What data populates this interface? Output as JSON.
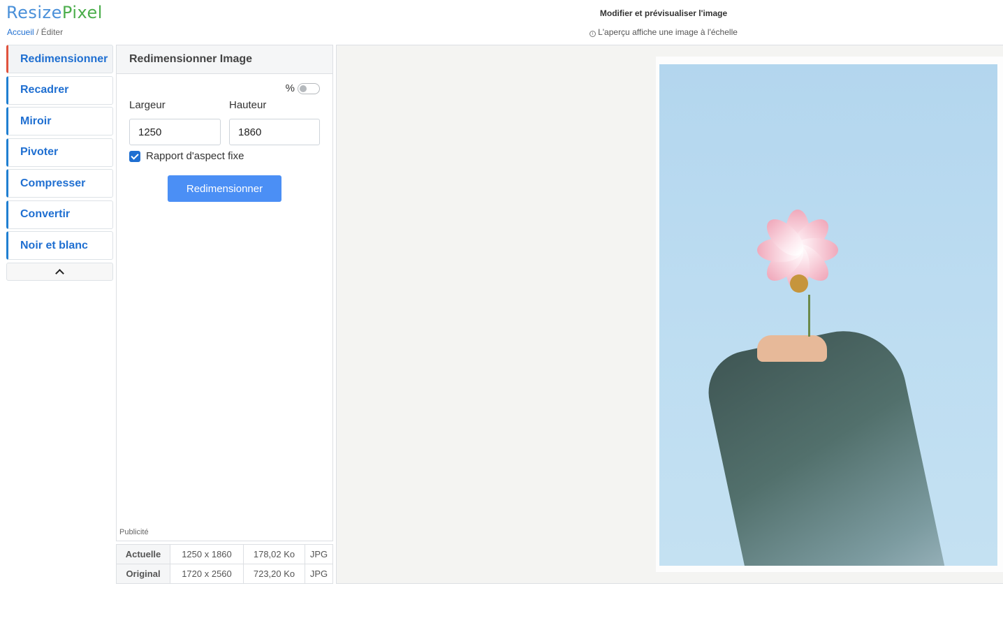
{
  "brand": {
    "part1": "Resize",
    "part2": "Pixel"
  },
  "breadcrumb": {
    "home": "Accueil",
    "separator": "/",
    "current": "Éditer"
  },
  "header": {
    "title": "Modifier et prévisualiser l'image",
    "note": "L'aperçu affiche une image à l'échelle"
  },
  "sidebar": {
    "items": [
      {
        "label": "Redimensionner",
        "active": true
      },
      {
        "label": "Recadrer"
      },
      {
        "label": "Miroir"
      },
      {
        "label": "Pivoter"
      },
      {
        "label": "Compresser"
      },
      {
        "label": "Convertir"
      },
      {
        "label": "Noir et blanc"
      }
    ],
    "collapse_icon": "chevron-up-icon"
  },
  "panel": {
    "title": "Redimensionner Image",
    "percent_label": "%",
    "percent_enabled": false,
    "width_label": "Largeur",
    "height_label": "Hauteur",
    "width_value": "1250",
    "height_value": "1860",
    "aspect_label": "Rapport d'aspect fixe",
    "aspect_checked": true,
    "button_label": "Redimensionner",
    "ad_label": "Publicité"
  },
  "info_table": [
    {
      "label": "Actuelle",
      "dimensions": "1250 x 1860",
      "size": "178,02 Ko",
      "format": "JPG"
    },
    {
      "label": "Original",
      "dimensions": "1720 x 2560",
      "size": "723,20 Ko",
      "format": "JPG"
    }
  ],
  "colors": {
    "accent": "#1f6fd1",
    "active_marker": "#e0533d",
    "button": "#4b8ff5",
    "brand_blue": "#4a90d9",
    "brand_green": "#4cae4c"
  }
}
